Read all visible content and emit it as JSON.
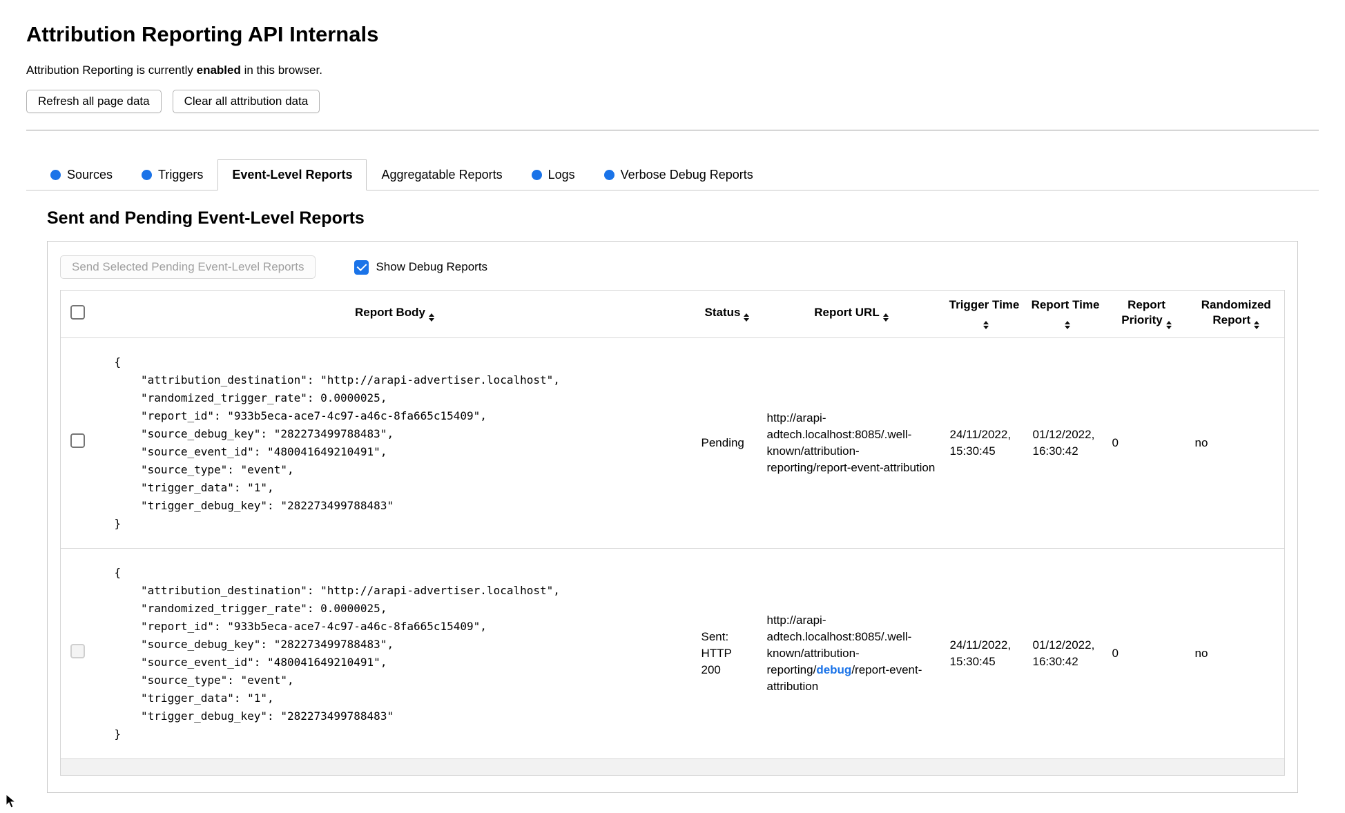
{
  "page": {
    "title": "Attribution Reporting API Internals",
    "status_prefix": "Attribution Reporting is currently ",
    "status_bold": "enabled",
    "status_suffix": " in this browser.",
    "refresh_button": "Refresh all page data",
    "clear_button": "Clear all attribution data"
  },
  "colors": {
    "accent_blue": "#1a73e8"
  },
  "tabs": [
    {
      "label": "Sources",
      "has_dot": true,
      "active": false
    },
    {
      "label": "Triggers",
      "has_dot": true,
      "active": false
    },
    {
      "label": "Event-Level Reports",
      "has_dot": false,
      "active": true
    },
    {
      "label": "Aggregatable Reports",
      "has_dot": false,
      "active": false
    },
    {
      "label": "Logs",
      "has_dot": true,
      "active": false
    },
    {
      "label": "Verbose Debug Reports",
      "has_dot": true,
      "active": false
    }
  ],
  "section": {
    "heading": "Sent and Pending Event-Level Reports",
    "send_button_label": "Send Selected Pending Event-Level Reports",
    "send_button_enabled": false,
    "show_debug_label": "Show Debug Reports",
    "show_debug_checked": true
  },
  "table": {
    "headers": [
      "Report Body",
      "Status",
      "Report URL",
      "Trigger Time",
      "Report Time",
      "Report Priority",
      "Randomized Report"
    ],
    "rows": [
      {
        "report_body": "{\n    \"attribution_destination\": \"http://arapi-advertiser.localhost\",\n    \"randomized_trigger_rate\": 0.0000025,\n    \"report_id\": \"933b5eca-ace7-4c97-a46c-8fa665c15409\",\n    \"source_debug_key\": \"282273499788483\",\n    \"source_event_id\": \"480041649210491\",\n    \"source_type\": \"event\",\n    \"trigger_data\": \"1\",\n    \"trigger_debug_key\": \"282273499788483\"\n}",
        "status": "Pending",
        "report_url_prefix": "http://arapi-adtech.localhost:8085/.well-known/attribution-reporting/",
        "report_url_debug": "",
        "report_url_suffix": "report-event-attribution",
        "trigger_time": "24/11/2022, 15:30:45",
        "report_time": "01/12/2022, 16:30:42",
        "report_priority": "0",
        "randomized_report": "no",
        "selectable": true
      },
      {
        "report_body": "{\n    \"attribution_destination\": \"http://arapi-advertiser.localhost\",\n    \"randomized_trigger_rate\": 0.0000025,\n    \"report_id\": \"933b5eca-ace7-4c97-a46c-8fa665c15409\",\n    \"source_debug_key\": \"282273499788483\",\n    \"source_event_id\": \"480041649210491\",\n    \"source_type\": \"event\",\n    \"trigger_data\": \"1\",\n    \"trigger_debug_key\": \"282273499788483\"\n}",
        "status": "Sent: HTTP 200",
        "report_url_prefix": "http://arapi-adtech.localhost:8085/.well-known/attribution-reporting/",
        "report_url_debug": "debug",
        "report_url_suffix": "/report-event-attribution",
        "trigger_time": "24/11/2022, 15:30:45",
        "report_time": "01/12/2022, 16:30:42",
        "report_priority": "0",
        "randomized_report": "no",
        "selectable": false
      }
    ]
  }
}
